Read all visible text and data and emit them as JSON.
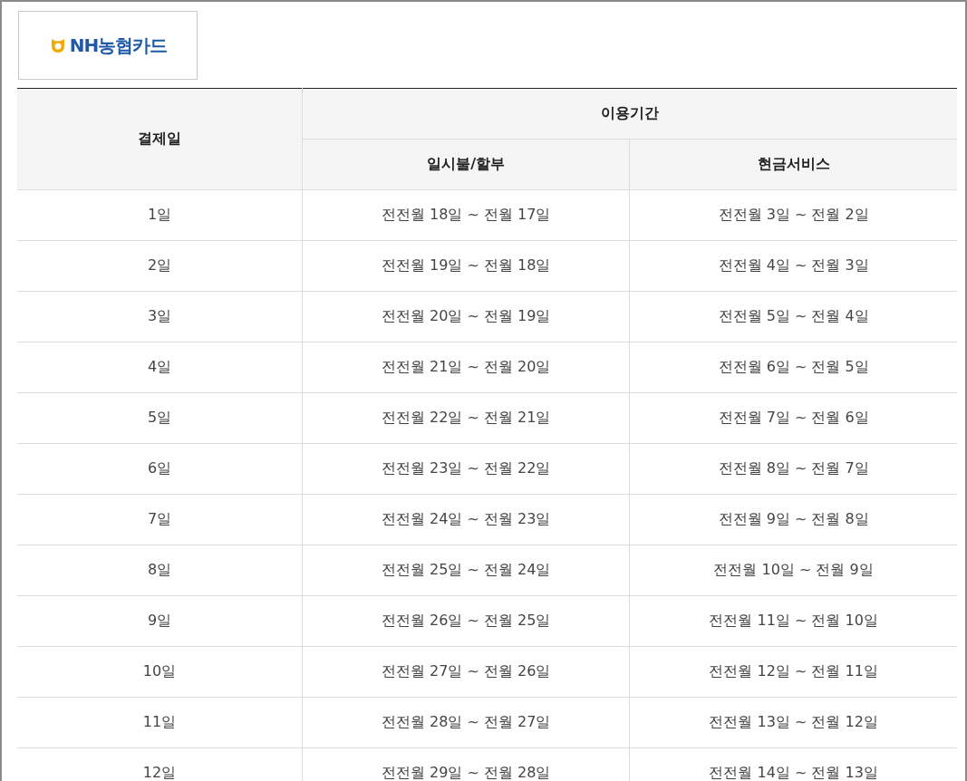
{
  "logo": {
    "text": "NH농협카드"
  },
  "table": {
    "group_header": "이용기간",
    "columns": [
      "결제일",
      "일시불/할부",
      "현금서비스"
    ],
    "rows": [
      [
        "1일",
        "전전월 18일 ~ 전월 17일",
        "전전월 3일 ~ 전월 2일"
      ],
      [
        "2일",
        "전전월 19일 ~ 전월 18일",
        "전전월 4일 ~ 전월 3일"
      ],
      [
        "3일",
        "전전월 20일 ~ 전월 19일",
        "전전월 5일 ~ 전월 4일"
      ],
      [
        "4일",
        "전전월 21일 ~ 전월 20일",
        "전전월 6일 ~ 전월 5일"
      ],
      [
        "5일",
        "전전월 22일 ~ 전월 21일",
        "전전월 7일 ~ 전월 6일"
      ],
      [
        "6일",
        "전전월 23일 ~ 전월 22일",
        "전전월 8일 ~ 전월 7일"
      ],
      [
        "7일",
        "전전월 24일 ~ 전월 23일",
        "전전월 9일 ~ 전월 8일"
      ],
      [
        "8일",
        "전전월 25일 ~ 전월 24일",
        "전전월 10일 ~ 전월 9일"
      ],
      [
        "9일",
        "전전월 26일 ~ 전월 25일",
        "전전월 11일 ~ 전월 10일"
      ],
      [
        "10일",
        "전전월 27일 ~ 전월 26일",
        "전전월 12일 ~ 전월 11일"
      ],
      [
        "11일",
        "전전월 28일 ~ 전월 27일",
        "전전월 13일 ~ 전월 12일"
      ],
      [
        "12일",
        "전전월 29일 ~ 전월 28일",
        "전전월 14일 ~ 전월 13일"
      ]
    ]
  }
}
